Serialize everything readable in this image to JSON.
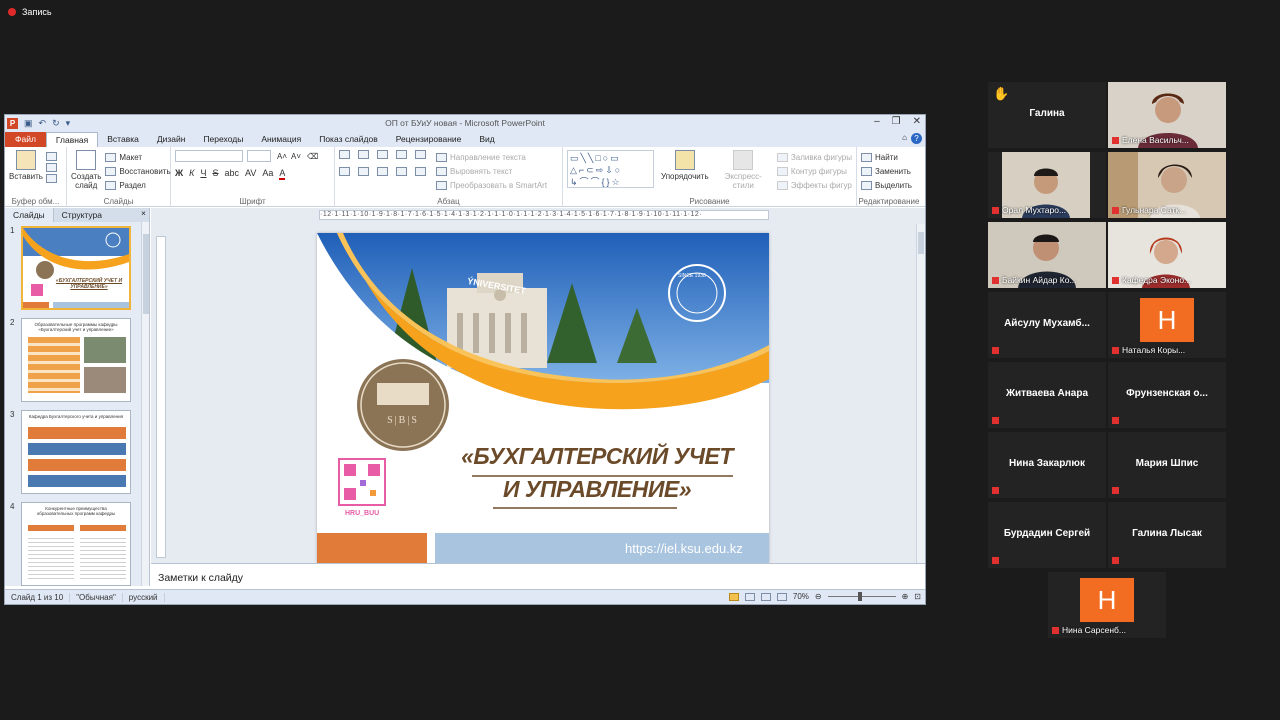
{
  "recording": {
    "label": "Запись"
  },
  "window": {
    "title": "ОП от БУиУ новая - Microsoft PowerPoint",
    "app_letter": "P"
  },
  "tabs": [
    "Файл",
    "Главная",
    "Вставка",
    "Дизайн",
    "Переходы",
    "Анимация",
    "Показ слайдов",
    "Рецензирование",
    "Вид"
  ],
  "ribbon": {
    "clipboard": {
      "paste": "Вставить",
      "label": "Буфер обм..."
    },
    "slides": {
      "new_slide": "Создать слайд",
      "layout": "Макет",
      "reset": "Восстановить",
      "section": "Раздел",
      "label": "Слайды"
    },
    "font": {
      "label": "Шрифт",
      "bold": "Ж",
      "italic": "К",
      "underline": "Ч",
      "strike": "S",
      "shadow": "abc",
      "spacing": "AV",
      "case": "Aa",
      "color": "A"
    },
    "paragraph": {
      "label": "Абзац",
      "text_direction": "Направление текста",
      "align_text": "Выровнять текст",
      "smartart": "Преобразовать в SmartArt"
    },
    "drawing": {
      "label": "Рисование",
      "arrange": "Упорядочить",
      "quick_styles": "Экспресс-стили",
      "fill": "Заливка фигуры",
      "outline": "Контур фигуры",
      "effects": "Эффекты фигур"
    },
    "editing": {
      "label": "Редактирование",
      "find": "Найти",
      "replace": "Заменить",
      "select": "Выделить"
    }
  },
  "left_pane": {
    "tab_slides": "Слайды",
    "tab_outline": "Структура",
    "close": "×",
    "thumbnails": [
      {
        "num": "1",
        "title": "«БУХГАЛТЕРСКИЙ УЧЕТ И УПРАВЛЕНИЕ»",
        "selected": true
      },
      {
        "num": "2",
        "title": "Образовательные программы кафедры «Бухгалтерский учет и управление»",
        "selected": false
      },
      {
        "num": "3",
        "title": "Кафедра Бухгалтерского учета и управления",
        "selected": false
      },
      {
        "num": "4",
        "title": "Конкурентные преимущества образовательных программ кафедры",
        "selected": false
      }
    ]
  },
  "ruler": "·12·1·11·1·10·1·9·1·8·1·7·1·6·1·5·1·4·1·3·1·2·1·1·1·0·1·1·1·2·1·3·1·4·1·5·1·6·1·7·1·8·1·9·1·10·1·11·1·12·",
  "slide": {
    "building_sign": "ÝNIVERSITET",
    "seal_text": "SINCE 1938",
    "logo_letters": "S|B|S",
    "qr_caption": "HRU_BUU",
    "title_line1": "«БУХГАЛТЕРСКИЙ УЧЕТ",
    "title_line2": "И УПРАВЛЕНИЕ»",
    "url": "https://iel.ksu.edu.kz",
    "colors": {
      "orange": "#f6a21c",
      "brown": "#8b7355",
      "blue_bar": "#a9c4de",
      "orange_block": "#e07b39"
    }
  },
  "notes": {
    "placeholder": "Заметки к слайду"
  },
  "status": {
    "slide_info": "Слайд 1 из 10",
    "theme": "\"Обычная\"",
    "language": "русский",
    "zoom": "70%"
  },
  "participants": [
    {
      "name": "Галина",
      "kind": "name",
      "hand": true
    },
    {
      "name": "Елена Васильч...",
      "kind": "video"
    },
    {
      "name": "Орал Мухтаро...",
      "kind": "video"
    },
    {
      "name": "Гульнара Сатк...",
      "kind": "video"
    },
    {
      "name": "Байкин Айдар Ко...",
      "kind": "video",
      "active": true
    },
    {
      "name": "Кафедра Эконо...",
      "kind": "video"
    },
    {
      "name": "Айсулу  Мухамб...",
      "kind": "name"
    },
    {
      "name": "Наталья Коры...",
      "kind": "avatar",
      "letter": "Н"
    },
    {
      "name": "Житваева Анара",
      "kind": "name"
    },
    {
      "name": "Фрунзенская  о...",
      "kind": "name"
    },
    {
      "name": "Нина Закарлюк",
      "kind": "name"
    },
    {
      "name": "Мария Шпис",
      "kind": "name"
    },
    {
      "name": "Бурдадин Сергей",
      "kind": "name"
    },
    {
      "name": "Галина Лысак",
      "kind": "name"
    },
    {
      "name": "Нина Сарсенб...",
      "kind": "avatar",
      "letter": "Н"
    }
  ]
}
